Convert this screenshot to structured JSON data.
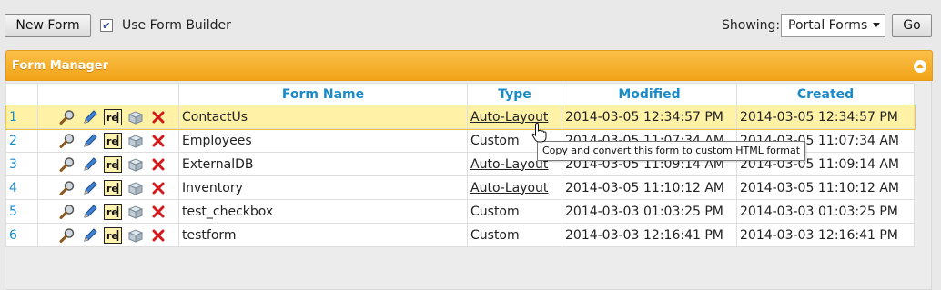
{
  "toolbar": {
    "new_form_label": "New Form",
    "use_form_builder_label": "Use Form Builder",
    "use_form_builder_checked": true,
    "showing_label": "Showing:",
    "showing_value": "Portal Forms",
    "go_label": "Go"
  },
  "panel": {
    "title": "Form Manager"
  },
  "table": {
    "columns": [
      "Form Name",
      "Type",
      "Modified",
      "Created"
    ],
    "rows": [
      {
        "num": "1",
        "name": "ContactUs",
        "type": "Auto-Layout",
        "type_link": true,
        "mod_date": "2014-03-05",
        "mod_time": "12:34:57 PM",
        "cre_date": "2014-03-05",
        "cre_time": "12:34:57 PM"
      },
      {
        "num": "2",
        "name": "Employees",
        "type": "Custom",
        "type_link": false,
        "mod_date": "2014-03-05",
        "mod_time": "11:07:34 AM",
        "cre_date": "2014-03-05",
        "cre_time": "11:07:34 AM"
      },
      {
        "num": "3",
        "name": "ExternalDB",
        "type": "Auto-Layout",
        "type_link": true,
        "mod_date": "2014-03-05",
        "mod_time": "11:09:14 AM",
        "cre_date": "2014-03-05",
        "cre_time": "11:09:14 AM"
      },
      {
        "num": "4",
        "name": "Inventory",
        "type": "Auto-Layout",
        "type_link": true,
        "mod_date": "2014-03-05",
        "mod_time": "11:10:12 AM",
        "cre_date": "2014-03-05",
        "cre_time": "11:10:12 AM"
      },
      {
        "num": "5",
        "name": "test_checkbox",
        "type": "Custom",
        "type_link": false,
        "mod_date": "2014-03-03",
        "mod_time": "01:03:25 PM",
        "cre_date": "2014-03-03",
        "cre_time": "01:03:25 PM"
      },
      {
        "num": "6",
        "name": "testform",
        "type": "Custom",
        "type_link": false,
        "mod_date": "2014-03-03",
        "mod_time": "12:16:41 PM",
        "cre_date": "2014-03-03",
        "cre_time": "12:16:41 PM"
      }
    ],
    "row_icons": [
      "magnifier-icon",
      "pencil-icon",
      "regex-icon",
      "copy-box-icon",
      "delete-x-icon"
    ],
    "regex_icon_text": "re"
  },
  "tooltip": {
    "text": "Copy and convert this form to custom HTML format"
  },
  "colors": {
    "header_orange": "#f5ae2b",
    "link_blue": "#1a8bc9",
    "selected_row": "#fff2a6",
    "delete_red": "#d21a1a"
  }
}
